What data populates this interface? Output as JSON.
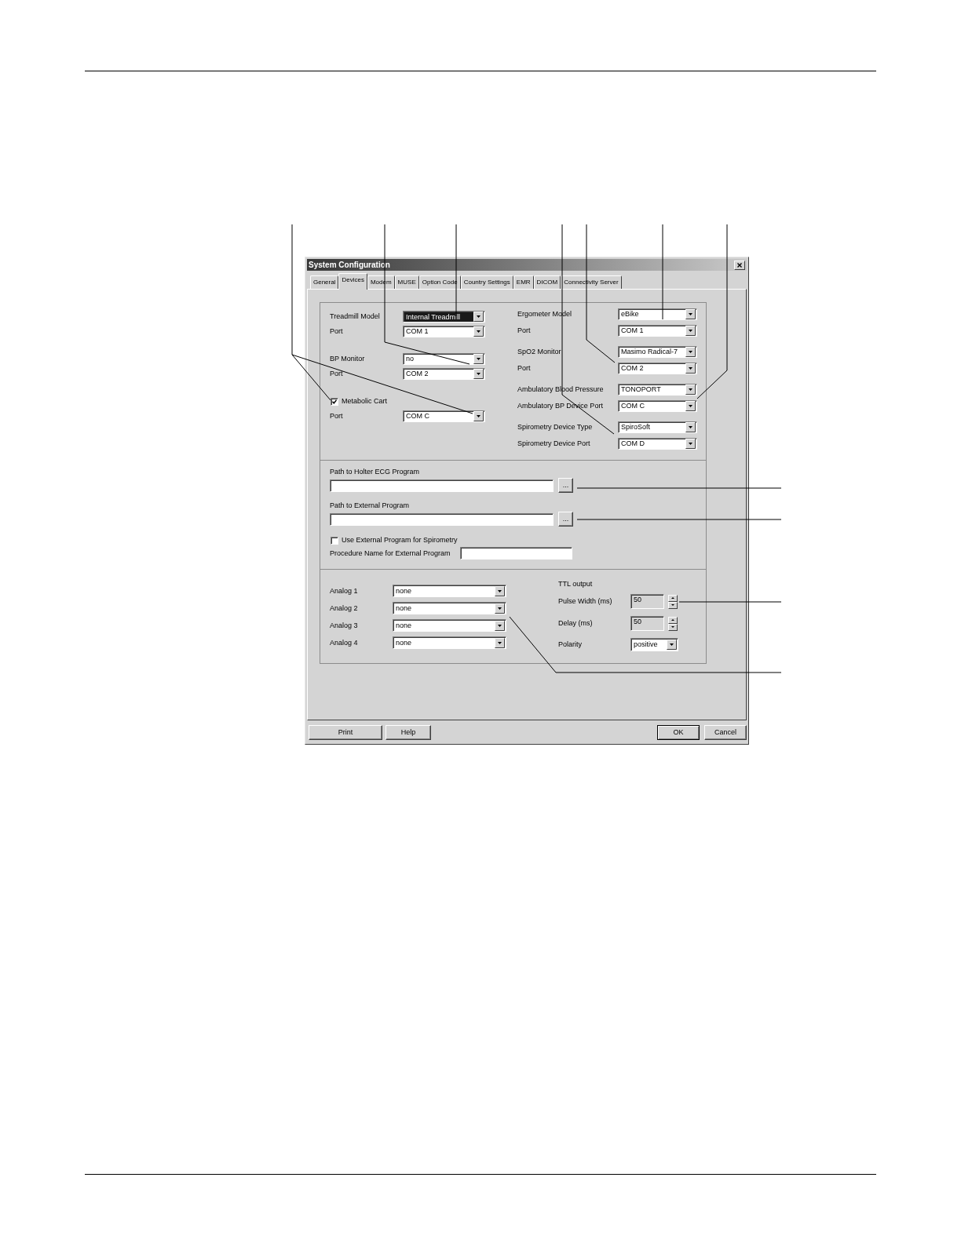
{
  "dialog": {
    "title": "System Configuration",
    "tabs": [
      {
        "label": "General",
        "selected": false
      },
      {
        "label": "Devices",
        "selected": true
      },
      {
        "label": "Modem",
        "selected": false
      },
      {
        "label": "MUSE",
        "selected": false
      },
      {
        "label": "Option Code",
        "selected": false
      },
      {
        "label": "Country Settings",
        "selected": false
      },
      {
        "label": "EMR",
        "selected": false
      },
      {
        "label": "DICOM",
        "selected": false
      },
      {
        "label": "Connectivity Server",
        "selected": false
      }
    ],
    "devices_left": [
      {
        "kind": "combo",
        "label": "Treadmill Model",
        "value": "Internal Treadmill",
        "focused": true
      },
      {
        "kind": "combo",
        "label": "Port",
        "value": "COM 1",
        "focused": false
      },
      {
        "kind": "combo",
        "label": "BP Monitor",
        "value": "no",
        "focused": false
      },
      {
        "kind": "combo",
        "label": "Port",
        "value": "COM 2",
        "focused": false
      },
      {
        "kind": "checkbox",
        "label": "Metabolic Cart",
        "checked": true
      },
      {
        "kind": "combo",
        "label": "Port",
        "value": "COM C",
        "focused": false
      }
    ],
    "devices_right": [
      {
        "label": "Ergometer Model",
        "value": "eBike"
      },
      {
        "label": "Port",
        "value": "COM 1"
      },
      {
        "label": "SpO2 Monitor",
        "value": "Masimo Radical-7"
      },
      {
        "label": "Port",
        "value": "COM 2"
      },
      {
        "label": "Ambulatory Blood Pressure",
        "value": "TONOPORT"
      },
      {
        "label": "Ambulatory BP Device Port",
        "value": "COM C"
      },
      {
        "label": "Spirometry Device Type",
        "value": "SpiroSoft"
      },
      {
        "label": "Spirometry Device Port",
        "value": "COM D"
      }
    ],
    "paths": [
      {
        "label": "Path to Holter ECG Program",
        "browse": "..."
      },
      {
        "label": "Path to External Program",
        "browse": "..."
      }
    ],
    "use_external_spirometry": {
      "label": "Use External Program for Spirometry",
      "checked": false
    },
    "procedure_name": {
      "label": "Procedure Name for External Program"
    },
    "analog_outputs": [
      {
        "label": "Analog 1",
        "value": "none"
      },
      {
        "label": "Analog 2",
        "value": "none"
      },
      {
        "label": "Analog 3",
        "value": "none"
      },
      {
        "label": "Analog 4",
        "value": "none"
      }
    ],
    "ttl_output": {
      "title": "TTL output",
      "rows": [
        {
          "kind": "spin",
          "label": "Pulse Width (ms)",
          "value": "50",
          "disabled": true
        },
        {
          "kind": "spin",
          "label": "Delay (ms)",
          "value": "50",
          "disabled": true
        },
        {
          "kind": "combo",
          "label": "Polarity",
          "value": "positive",
          "disabled": false
        }
      ]
    },
    "buttons_left": [
      {
        "label": "Print",
        "default": false
      },
      {
        "label": "Help",
        "default": false
      }
    ],
    "buttons_right": [
      {
        "label": "OK",
        "default": true
      },
      {
        "label": "Cancel",
        "default": false
      }
    ]
  }
}
